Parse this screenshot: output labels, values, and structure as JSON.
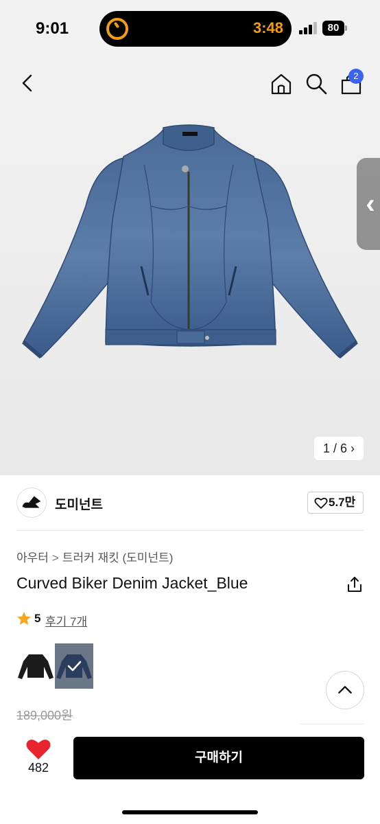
{
  "status_bar": {
    "time": "9:01",
    "island_time": "3:48",
    "battery": "80"
  },
  "header": {
    "cart_count": "2"
  },
  "gallery": {
    "pager": "1 / 6",
    "pager_arrow": "›"
  },
  "brand": {
    "name": "도미넌트",
    "likes": "5.7만"
  },
  "breadcrumb": {
    "category": "아우터",
    "separator": ">",
    "subcategory": "트러커 재킷 (도미넌트)"
  },
  "product": {
    "title": "Curved Biker Denim Jacket_Blue",
    "rating": "5",
    "reviews": "후기 7개",
    "original_price": "189,000원"
  },
  "bottom_bar": {
    "like_count": "482",
    "buy_label": "구매하기"
  },
  "colors": {
    "accent_badge": "#3a64f0",
    "heart": "#e8252f",
    "star": "#f5a623",
    "denim": "#3e5f8f"
  }
}
